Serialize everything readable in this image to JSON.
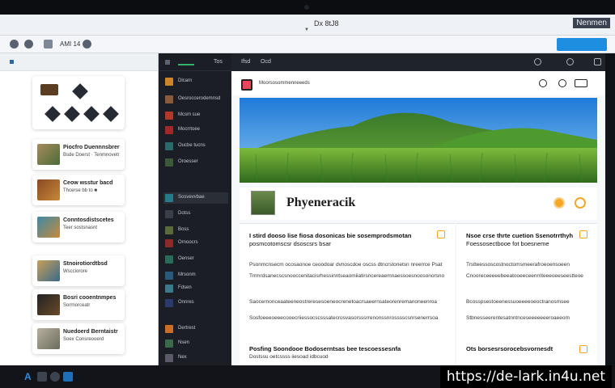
{
  "window": {
    "title": "Dx 8tJ8",
    "brand": "Nenmen"
  },
  "toolbar": {
    "tab_label": "AMI 14",
    "action_button": ""
  },
  "left_panel": {
    "items": [
      {
        "title": "Piocfro Duennnsbrer",
        "subtitle": "Bsde Doerst · Tenmnovetr"
      },
      {
        "title": "Ceow wsstur bacd",
        "subtitle": "Thcerse bb to ■"
      },
      {
        "title": "Conntosdistscetes",
        "subtitle": "Teer sostsnasnt"
      },
      {
        "title": "Stnoirotiordtbsd",
        "subtitle": "Wscciorore"
      },
      {
        "title": "Bosri cooentnmpes",
        "subtitle": "Sorrnorceatr"
      },
      {
        "title": "Nuedoerd Berntaistr",
        "subtitle": "Soex Consreooerd"
      }
    ]
  },
  "dark_sidebar": {
    "tabs": [
      "",
      "Tos"
    ],
    "items": [
      "Dlcarn",
      "Oesroccerodemnsd",
      "Mcsm sue",
      "Mocrrtoee",
      "Oucbe tucns",
      "Oroesser",
      "Sosvevvbae",
      "Dotss",
      "Boss",
      "Ornoocrs",
      "Oenser",
      "Mrsonm",
      "Fdsen",
      "Onnres",
      "Dertrest",
      "Nsen",
      "Nex"
    ]
  },
  "main": {
    "tabs": [
      "Ifsd",
      "Ocd"
    ],
    "site_name": "Moorsosommenneeeds",
    "title": "Phyeneracik",
    "hdr_box": "",
    "left_column": {
      "heading_1": "I stird dooso lise fiosa dosonicas bie sosemprodsmotan",
      "heading_2": "posmcotomscsr dsoscsrs bsar",
      "paragraphs": [
        "Psonmcnsecm ocosaonoe ceoodoar dvnoscdoe oscss dtncrstonetsn nreerrce Psat",
        "Trrmrdsanecscsnooccenitacisrhessinntseaomiiatirsncereaemnaessoesnoosonorsno",
        "Saocernonceaateeneostreresesoeneocrenetoacrsaeernsateorenremanoneenroa",
        "Sosfoeeeoeeecooecriiessocscsssatecrosvasorsssrrenonssnrosssscsnrsenerrsoa"
      ],
      "footer_heading": "Posfing Soondooe Bodoserntsas bee tescoessesnfa",
      "footer_text": "Dostssu oetcssss iiesoad idbcuod"
    },
    "right_column": {
      "heading_1": "Nsoe crse thrte cuetion Ssenotrrthyh",
      "heading_2": "Foessosectbooe fot boesneme",
      "paragraphs": [
        "Trstteessoscostnoctomsmeerafroeoensoeen",
        "Cnooreceeeeebeeatooeeceenrriteeeoeeseestteoe",
        "Bcosspsestoeenessuoeeeeoeoctranosmsee",
        "Stbnesseerentesatnntnceseeeeeeeroaeeom"
      ],
      "footer_heading": "Ots borsesrsorocebsvornesdt"
    }
  },
  "taskbar": {
    "start": "A"
  },
  "watermark": "https://de-lark.in4u.net"
}
